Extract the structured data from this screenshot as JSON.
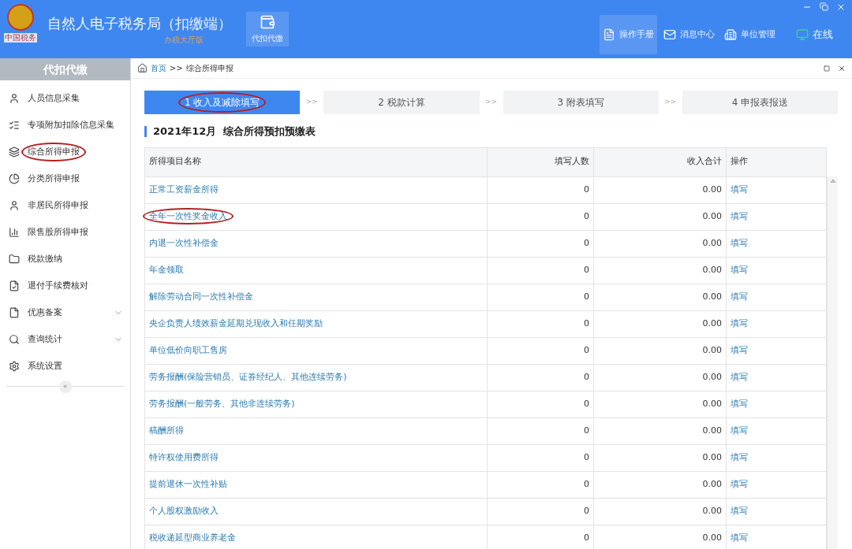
{
  "header": {
    "title": "自然人电子税务局（扣缴端）",
    "subtitle": "办税大厅版",
    "logo_text": "中国税务",
    "module": {
      "label": "代扣代缴",
      "selected": true
    },
    "actions": [
      {
        "kind": "manual",
        "label": "操作手册",
        "selected": true
      },
      {
        "kind": "message",
        "label": "消息中心",
        "selected": false
      },
      {
        "kind": "unit",
        "label": "单位管理",
        "selected": false
      },
      {
        "kind": "online",
        "label": "在线",
        "selected": false
      }
    ]
  },
  "sidebar": {
    "title": "代扣代缴",
    "items": [
      {
        "kind": "person",
        "label": "人员信息采集",
        "expandable": false,
        "circled": false
      },
      {
        "kind": "list",
        "label": "专项附加扣除信息采集",
        "expandable": false,
        "circled": false
      },
      {
        "kind": "layers",
        "label": "综合所得申报",
        "expandable": false,
        "circled": true
      },
      {
        "kind": "pie",
        "label": "分类所得申报",
        "expandable": false,
        "circled": false
      },
      {
        "kind": "person",
        "label": "非居民所得申报",
        "expandable": false,
        "circled": false
      },
      {
        "kind": "chart",
        "label": "限售股所得申报",
        "expandable": false,
        "circled": false
      },
      {
        "kind": "folder",
        "label": "税款缴纳",
        "expandable": false,
        "circled": false
      },
      {
        "kind": "doc",
        "label": "退付手续费核对",
        "expandable": false,
        "circled": false
      },
      {
        "kind": "page",
        "label": "优惠备案",
        "expandable": true,
        "circled": false
      },
      {
        "kind": "search",
        "label": "查询统计",
        "expandable": true,
        "circled": false
      },
      {
        "kind": "gear",
        "label": "系统设置",
        "expandable": false,
        "circled": false
      }
    ],
    "collapse": "«"
  },
  "breadcrumb": {
    "home": "首页",
    "separator": ">>",
    "current": "综合所得申报"
  },
  "steps": [
    {
      "label": "1 收入及减除填写",
      "selected": true,
      "circled": true
    },
    {
      "label": "2 税款计算",
      "selected": false,
      "circled": false
    },
    {
      "label": "3 附表填写",
      "selected": false,
      "circled": false
    },
    {
      "label": "4 申报表报送",
      "selected": false,
      "circled": false
    }
  ],
  "step_separator": ">>",
  "section_title": "2021年12月  综合所得预扣预缴表",
  "table": {
    "columns": [
      "所得项目名称",
      "填写人数",
      "收入合计",
      "操作"
    ],
    "rows": [
      {
        "name": "正常工资薪金所得",
        "count": "0",
        "total": "0.00",
        "action": "填写",
        "circled": false
      },
      {
        "name": "全年一次性奖金收入",
        "count": "0",
        "total": "0.00",
        "action": "填写",
        "circled": true
      },
      {
        "name": "内退一次性补偿金",
        "count": "0",
        "total": "0.00",
        "action": "填写",
        "circled": false
      },
      {
        "name": "年金领取",
        "count": "0",
        "total": "0.00",
        "action": "填写",
        "circled": false
      },
      {
        "name": "解除劳动合同一次性补偿金",
        "count": "0",
        "total": "0.00",
        "action": "填写",
        "circled": false
      },
      {
        "name": "央企负责人绩效薪金延期兑现收入和任期奖励",
        "count": "0",
        "total": "0.00",
        "action": "填写",
        "circled": false
      },
      {
        "name": "单位低价向职工售房",
        "count": "0",
        "total": "0.00",
        "action": "填写",
        "circled": false
      },
      {
        "name": "劳务报酬(保险营销员、证券经纪人、其他连续劳务)",
        "count": "0",
        "total": "0.00",
        "action": "填写",
        "circled": false
      },
      {
        "name": "劳务报酬(一般劳务、其他非连续劳务)",
        "count": "0",
        "total": "0.00",
        "action": "填写",
        "circled": false
      },
      {
        "name": "稿酬所得",
        "count": "0",
        "total": "0.00",
        "action": "填写",
        "circled": false
      },
      {
        "name": "特许权使用费所得",
        "count": "0",
        "total": "0.00",
        "action": "填写",
        "circled": false
      },
      {
        "name": "提前退休一次性补贴",
        "count": "0",
        "total": "0.00",
        "action": "填写",
        "circled": false
      },
      {
        "name": "个人股权激励收入",
        "count": "0",
        "total": "0.00",
        "action": "填写",
        "circled": false
      },
      {
        "name": "税收递延型商业养老金",
        "count": "0",
        "total": "0.00",
        "action": "填写",
        "circled": false
      }
    ]
  }
}
